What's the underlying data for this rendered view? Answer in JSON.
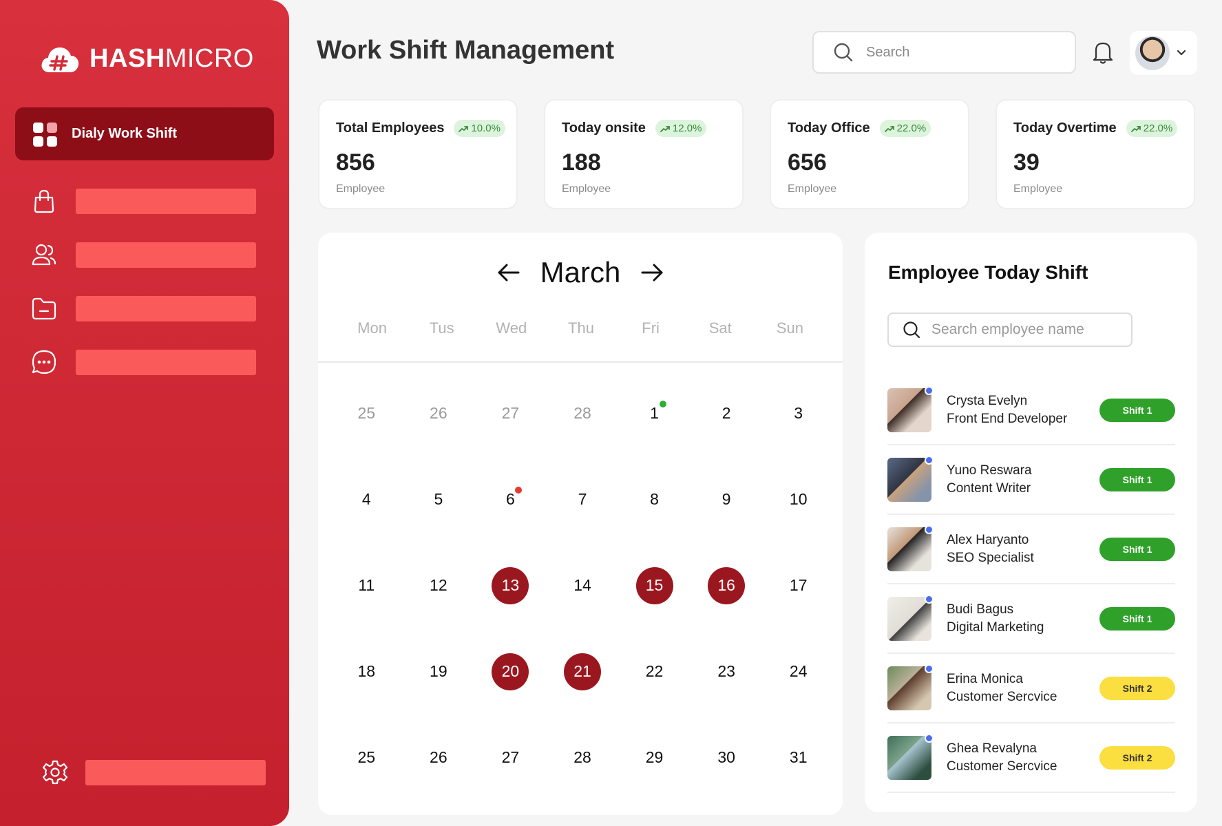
{
  "sidebar": {
    "brand": {
      "bold": "HASH",
      "light": "MICRO"
    },
    "active_item": "Dialy Work Shift",
    "nav_icons": [
      "shopping-bag-icon",
      "users-icon",
      "folder-icon",
      "chat-icon"
    ],
    "settings_icon": "gear-icon"
  },
  "header": {
    "title": "Work Shift Management",
    "search_placeholder": "Search"
  },
  "stats": [
    {
      "label": "Total Employees",
      "change": "10.0%",
      "value": "856",
      "unit": "Employee"
    },
    {
      "label": "Today onsite",
      "change": "12.0%",
      "value": "188",
      "unit": "Employee"
    },
    {
      "label": "Today Office",
      "change": "22.0%",
      "value": "656",
      "unit": "Employee"
    },
    {
      "label": "Today Overtime",
      "change": "22.0%",
      "value": "39",
      "unit": "Employee"
    }
  ],
  "calendar": {
    "month": "March",
    "weekdays": [
      "Mon",
      "Tus",
      "Wed",
      "Thu",
      "Fri",
      "Sat",
      "Sun"
    ],
    "days": [
      {
        "n": "25",
        "muted": true
      },
      {
        "n": "26",
        "muted": true
      },
      {
        "n": "27",
        "muted": true
      },
      {
        "n": "28",
        "muted": true
      },
      {
        "n": "1",
        "dot": "green"
      },
      {
        "n": "2"
      },
      {
        "n": "3"
      },
      {
        "n": "4"
      },
      {
        "n": "5"
      },
      {
        "n": "6",
        "dot": "red"
      },
      {
        "n": "7"
      },
      {
        "n": "8"
      },
      {
        "n": "9"
      },
      {
        "n": "10"
      },
      {
        "n": "11"
      },
      {
        "n": "12"
      },
      {
        "n": "13",
        "selected": true
      },
      {
        "n": "14"
      },
      {
        "n": "15",
        "selected": true
      },
      {
        "n": "16",
        "selected": true
      },
      {
        "n": "17"
      },
      {
        "n": "18"
      },
      {
        "n": "19"
      },
      {
        "n": "20",
        "selected": true
      },
      {
        "n": "21",
        "selected": true
      },
      {
        "n": "22"
      },
      {
        "n": "23"
      },
      {
        "n": "24"
      },
      {
        "n": "25"
      },
      {
        "n": "26"
      },
      {
        "n": "27"
      },
      {
        "n": "28"
      },
      {
        "n": "29"
      },
      {
        "n": "30"
      },
      {
        "n": "31"
      }
    ],
    "colors": {
      "selected": "#9b1720",
      "dot_green": "#2eae3a",
      "dot_red": "#e53a2e"
    }
  },
  "employees": {
    "title": "Employee Today Shift",
    "search_placeholder": "Search employee name",
    "list": [
      {
        "name": "Crysta Evelyn",
        "role": "Front End Developer",
        "shift": "Shift 1",
        "level": 1
      },
      {
        "name": "Yuno Reswara",
        "role": "Content Writer",
        "shift": "Shift 1",
        "level": 1
      },
      {
        "name": "Alex Haryanto",
        "role": "SEO Specialist",
        "shift": "Shift 1",
        "level": 1
      },
      {
        "name": "Budi Bagus",
        "role": "Digital Marketing",
        "shift": "Shift 1",
        "level": 1
      },
      {
        "name": "Erina Monica",
        "role": "Customer Sercvice",
        "shift": "Shift 2",
        "level": 2
      },
      {
        "name": "Ghea Revalyna",
        "role": "Customer Sercvice",
        "shift": "Shift 2",
        "level": 2
      }
    ]
  }
}
